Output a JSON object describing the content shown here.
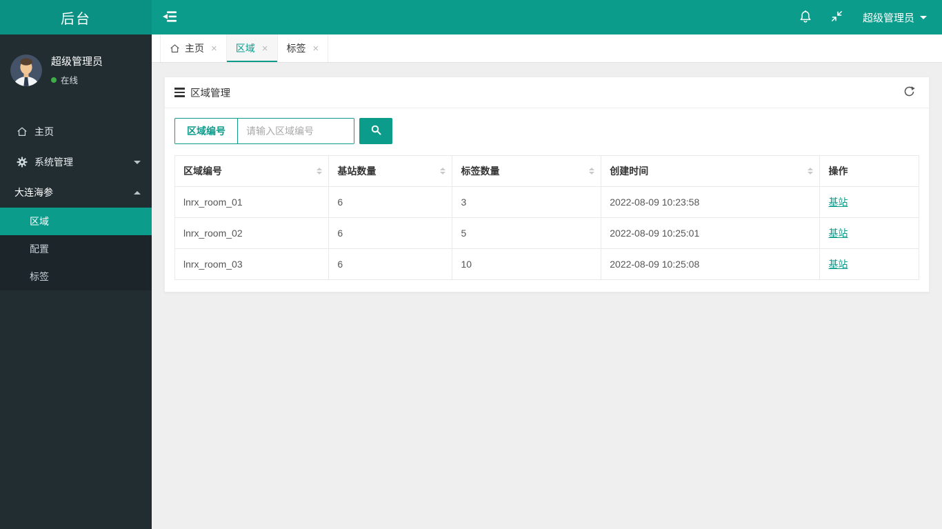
{
  "colors": {
    "accent_teal": "#0b9c8c",
    "logo_teal": "#0a9183",
    "sidebar_bg": "#222d32",
    "submenu_bg": "#1c252a",
    "online_green": "#3fae49",
    "content_bg": "#efefef"
  },
  "topbar": {
    "logo_text": "后台",
    "user_label": "超级管理员"
  },
  "sidebar": {
    "user": {
      "name": "超级管理员",
      "status": "在线"
    },
    "menu": [
      {
        "label": "主页",
        "icon": "home"
      },
      {
        "label": "系统管理",
        "icon": "gear",
        "state": "collapsed"
      },
      {
        "label": "大连海参",
        "icon": "none",
        "state": "expanded",
        "children": [
          {
            "label": "区域",
            "active": true
          },
          {
            "label": "配置",
            "active": false
          },
          {
            "label": "标签",
            "active": false
          }
        ]
      }
    ]
  },
  "tabs": {
    "close_glyph": "×",
    "items": [
      {
        "label": "主页",
        "icon": "home",
        "active": false
      },
      {
        "label": "区域",
        "active": true
      },
      {
        "label": "标签",
        "active": false
      }
    ]
  },
  "panel": {
    "title": "区域管理",
    "search": {
      "field_label": "区域编号",
      "placeholder": "请输入区域编号"
    },
    "table": {
      "columns": [
        {
          "label": "区域编号",
          "sortable": true
        },
        {
          "label": "基站数量",
          "sortable": true
        },
        {
          "label": "标签数量",
          "sortable": true
        },
        {
          "label": "创建时间",
          "sortable": true
        },
        {
          "label": "操作",
          "sortable": false
        }
      ],
      "rows": [
        {
          "region_id": "lnrx_room_01",
          "base_station_count": "6",
          "tag_count": "3",
          "created_at": "2022-08-09 10:23:58",
          "action": "基站"
        },
        {
          "region_id": "lnrx_room_02",
          "base_station_count": "6",
          "tag_count": "5",
          "created_at": "2022-08-09 10:25:01",
          "action": "基站"
        },
        {
          "region_id": "lnrx_room_03",
          "base_station_count": "6",
          "tag_count": "10",
          "created_at": "2022-08-09 10:25:08",
          "action": "基站"
        }
      ]
    }
  }
}
